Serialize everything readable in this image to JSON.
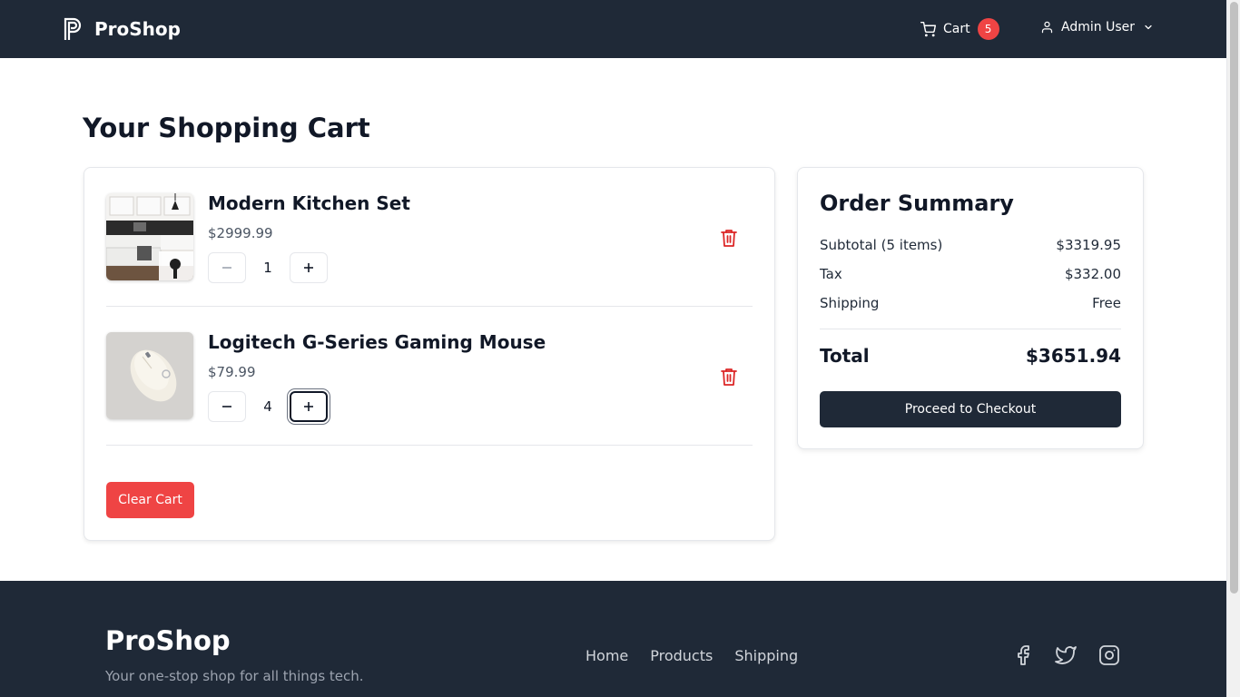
{
  "navbar": {
    "brand": "ProShop",
    "cart_label": "Cart",
    "cart_count": "5",
    "user_label": "Admin User"
  },
  "page": {
    "title": "Your Shopping Cart"
  },
  "cart": {
    "items": [
      {
        "name": "Modern Kitchen Set",
        "price": "$2999.99",
        "quantity": "1"
      },
      {
        "name": "Logitech G-Series Gaming Mouse",
        "price": "$79.99",
        "quantity": "4"
      }
    ],
    "clear_label": "Clear Cart"
  },
  "summary": {
    "title": "Order Summary",
    "rows": [
      {
        "label": "Subtotal (5 items)",
        "value": "$3319.95"
      },
      {
        "label": "Tax",
        "value": "$332.00"
      },
      {
        "label": "Shipping",
        "value": "Free"
      }
    ],
    "total_label": "Total",
    "total_value": "$3651.94",
    "checkout_label": "Proceed to Checkout"
  },
  "footer": {
    "brand": "ProShop",
    "tagline": "Your one-stop shop for all things tech.",
    "links": [
      "Home",
      "Products",
      "Shipping"
    ]
  },
  "colors": {
    "navbar_bg": "#1f2937",
    "badge": "#ef4444",
    "danger": "#ef4444",
    "primary_button": "#1f2937"
  }
}
